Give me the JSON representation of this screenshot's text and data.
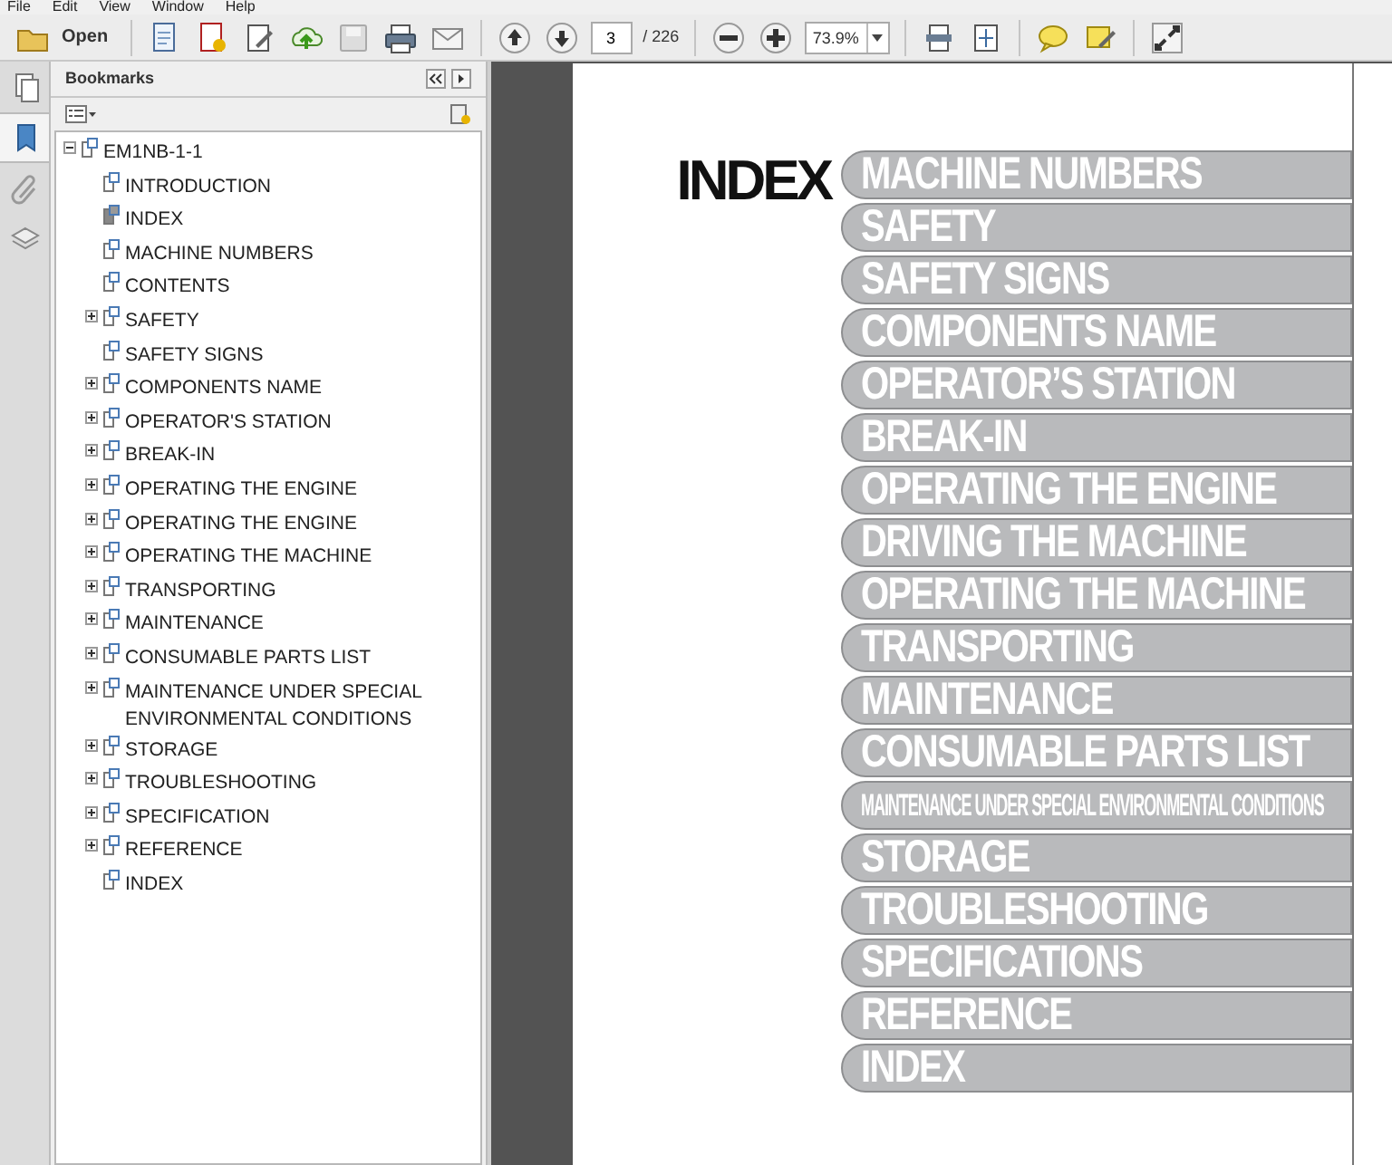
{
  "menu": [
    "File",
    "Edit",
    "View",
    "Window",
    "Help"
  ],
  "toolbar": {
    "open_label": "Open",
    "page": "3",
    "page_count": "/ 226",
    "zoom": "73.9%"
  },
  "side_tabs": [
    {
      "kind": "pages",
      "selected": false
    },
    {
      "kind": "bookmarks",
      "selected": true
    },
    {
      "kind": "attachments",
      "selected": false
    },
    {
      "kind": "layers",
      "selected": false
    }
  ],
  "bookmarks": {
    "title": "Bookmarks",
    "tree": [
      {
        "label": "EM1NB-1-1",
        "expanded": true,
        "selected": false,
        "children": [
          {
            "label": "INTRODUCTION",
            "selected": false
          },
          {
            "label": "INDEX",
            "selected": true
          },
          {
            "label": "MACHINE NUMBERS",
            "selected": false
          },
          {
            "label": "CONTENTS",
            "selected": false
          },
          {
            "label": "SAFETY",
            "expanded": false,
            "selected": false
          },
          {
            "label": "SAFETY SIGNS",
            "selected": false
          },
          {
            "label": "COMPONENTS NAME",
            "expanded": false,
            "selected": false
          },
          {
            "label": "OPERATOR'S STATION",
            "expanded": false,
            "selected": false
          },
          {
            "label": "BREAK-IN",
            "expanded": false,
            "selected": false
          },
          {
            "label": "OPERATING THE ENGINE",
            "expanded": false,
            "selected": false
          },
          {
            "label": "OPERATING THE ENGINE",
            "expanded": false,
            "selected": false
          },
          {
            "label": "OPERATING THE MACHINE",
            "expanded": false,
            "selected": false
          },
          {
            "label": "TRANSPORTING",
            "expanded": false,
            "selected": false
          },
          {
            "label": "MAINTENANCE",
            "expanded": false,
            "selected": false
          },
          {
            "label": "CONSUMABLE PARTS LIST",
            "expanded": false,
            "selected": false
          },
          {
            "label": "MAINTENANCE UNDER SPECIAL ENVIRONMENTAL CONDITIONS",
            "expanded": false,
            "selected": false
          },
          {
            "label": "STORAGE",
            "expanded": false,
            "selected": false
          },
          {
            "label": "TROUBLESHOOTING",
            "expanded": false,
            "selected": false
          },
          {
            "label": "SPECIFICATION",
            "expanded": false,
            "selected": false
          },
          {
            "label": "REFERENCE",
            "expanded": false,
            "selected": false
          },
          {
            "label": "INDEX",
            "selected": false
          }
        ]
      }
    ]
  },
  "document": {
    "heading": "INDEX",
    "tabs": [
      {
        "label": "MACHINE NUMBERS",
        "kind": "normal"
      },
      {
        "label": "SAFETY",
        "kind": "normal"
      },
      {
        "label": "SAFETY SIGNS",
        "kind": "normal"
      },
      {
        "label": "COMPONENTS NAME",
        "kind": "normal"
      },
      {
        "label": "OPERATOR’S STATION",
        "kind": "normal"
      },
      {
        "label": "BREAK-IN",
        "kind": "normal"
      },
      {
        "label": "OPERATING THE ENGINE",
        "kind": "normal"
      },
      {
        "label": "DRIVING THE MACHINE",
        "kind": "normal"
      },
      {
        "label": "OPERATING THE MACHINE",
        "kind": "normal"
      },
      {
        "label": "TRANSPORTING",
        "kind": "normal"
      },
      {
        "label": "MAINTENANCE",
        "kind": "normal"
      },
      {
        "label": "CONSUMABLE PARTS LIST",
        "kind": "normal"
      },
      {
        "label": "MAINTENANCE UNDER SPECIAL ENVIRONMENTAL CONDITIONS",
        "kind": "compressed"
      },
      {
        "label": "STORAGE",
        "kind": "normal"
      },
      {
        "label": "TROUBLESHOOTING",
        "kind": "normal"
      },
      {
        "label": "SPECIFICATIONS",
        "kind": "normal"
      },
      {
        "label": "REFERENCE",
        "kind": "normal"
      },
      {
        "label": "INDEX",
        "kind": "normal"
      }
    ]
  }
}
